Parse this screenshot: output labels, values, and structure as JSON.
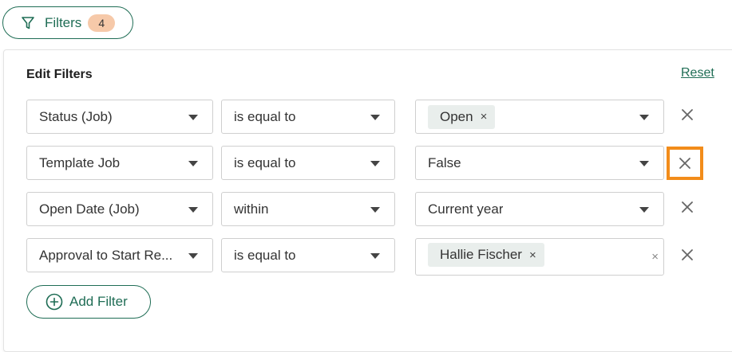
{
  "filters_button": {
    "label": "Filters",
    "count": "4",
    "icon": "funnel-icon"
  },
  "panel": {
    "title": "Edit Filters",
    "reset_label": "Reset"
  },
  "rows": [
    {
      "field": "Status (Job)",
      "operator": "is equal to",
      "value_chip": "Open",
      "chip_remove": "×",
      "remove": "×"
    },
    {
      "field": "Template Job",
      "operator": "is equal to",
      "value": "False",
      "remove": "×",
      "highlighted": true
    },
    {
      "field": "Open Date (Job)",
      "operator": "within",
      "value": "Current year",
      "remove": "×"
    },
    {
      "field": "Approval to Start Re...",
      "operator": "is equal to",
      "value_chip": "Hallie Fischer",
      "chip_remove": "×",
      "clear": "×",
      "remove": "×"
    }
  ],
  "add_filter": {
    "label": "Add Filter",
    "icon": "plus-circle-icon"
  },
  "colors": {
    "brand": "#1f6d55",
    "badge": "#f6c9a9",
    "highlight": "#f28c1a",
    "chip_bg": "#e9eeec"
  }
}
